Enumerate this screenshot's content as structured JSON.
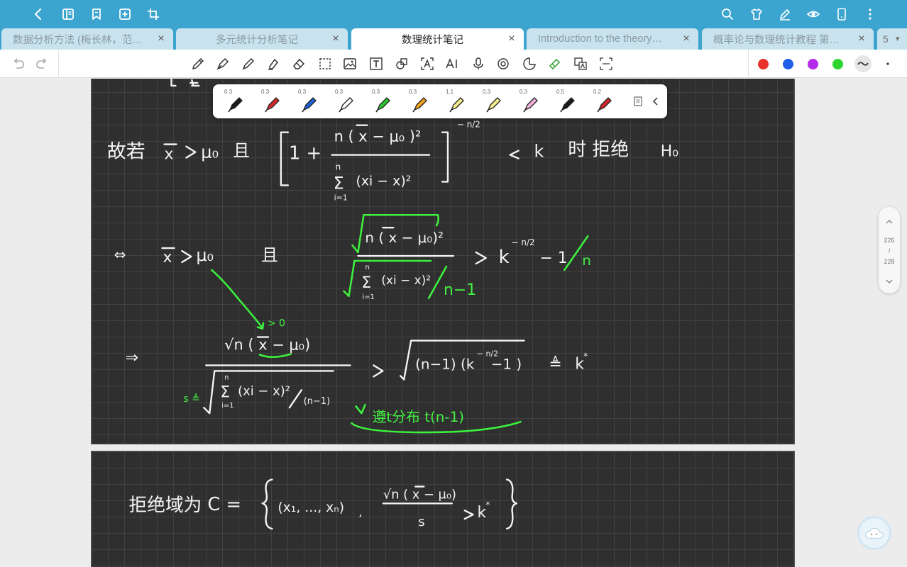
{
  "tabs": [
    {
      "label": "数据分析方法 (梅长林，范…",
      "active": false
    },
    {
      "label": "多元统计分析笔记",
      "active": false
    },
    {
      "label": "数理统计笔记",
      "active": true
    },
    {
      "label": "Introduction to the theory…",
      "active": false
    },
    {
      "label": "概率论与数理统计教程 第…",
      "active": false
    }
  ],
  "tab_count": "5",
  "tab_close_glyph": "×",
  "pen_palette": [
    {
      "size": "0.3",
      "color": "#1a1a1a"
    },
    {
      "size": "0.3",
      "color": "#d12a2a"
    },
    {
      "size": "0.3",
      "color": "#1f5fd6"
    },
    {
      "size": "0.3",
      "color": "#ffffff"
    },
    {
      "size": "0.3",
      "color": "#2fc42f"
    },
    {
      "size": "0.3",
      "color": "#f0a020"
    },
    {
      "size": "1.1",
      "color": "#f4ee8a"
    },
    {
      "size": "0.3",
      "color": "#f4ee8a"
    },
    {
      "size": "0.3",
      "color": "#f2b0d8"
    },
    {
      "size": "0.5",
      "color": "#1a1a1a"
    },
    {
      "size": "0.2",
      "color": "#d12a2a"
    }
  ],
  "toolbar_colors": [
    "#e8322b",
    "#1f5fe8",
    "#b52bea",
    "#2fd52f"
  ],
  "page_indicator": {
    "current": "226",
    "sep": "/",
    "total": "228"
  },
  "note": {
    "line1_text": "故若",
    "line1_qie": "且",
    "line1_end": "时 拒绝",
    "line2_prefix": "⇔",
    "line2_qie": "且",
    "line3_prefix": "⇒",
    "green_annotation": "遵t分布 t(n-1)",
    "green_gt0": "> 0",
    "page2_title": "拒绝域为"
  },
  "colors": {
    "topbar": "#3ba4cf",
    "page_bg": "#2f2f2f",
    "ink": "#f3f3f3",
    "ink_green": "#3df03d"
  }
}
